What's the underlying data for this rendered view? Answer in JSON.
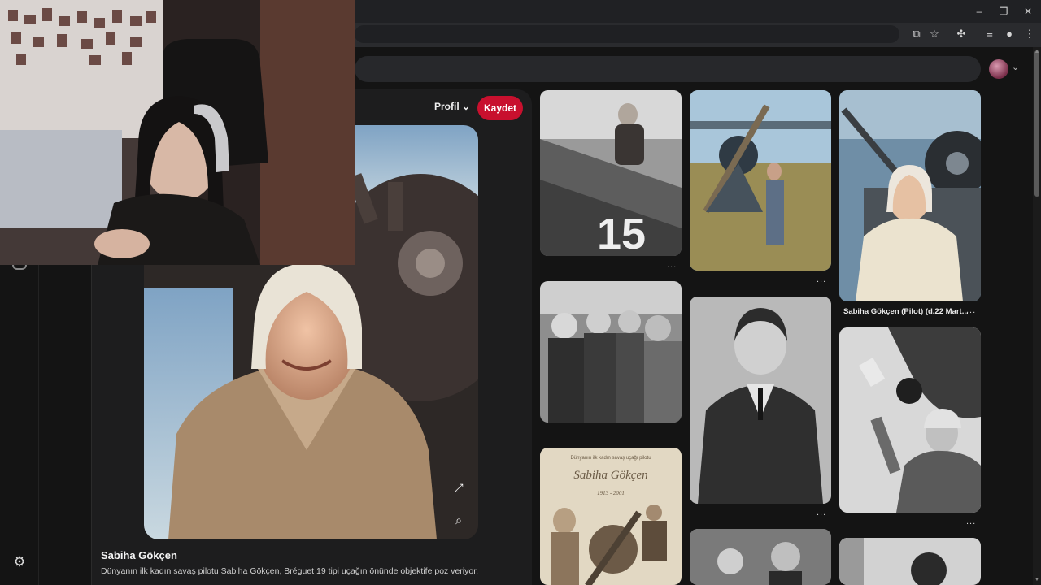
{
  "browser": {
    "window_controls": {
      "minimize": "–",
      "restore": "❐",
      "close": "✕"
    },
    "toolbar_icons": [
      "cast-icon",
      "star-icon",
      "extensions-icon",
      "media-icon",
      "profile-icon",
      "menu-icon"
    ]
  },
  "header": {
    "search_placeholder": ""
  },
  "pin": {
    "profile_label": "Profil",
    "save_label": "Kaydet",
    "title": "Sabiha Gökçen",
    "description": "Dünyanın ilk kadın savaş pilotu Sabiha Gökçen, Bréguet 19 tipi uçağın önünde objektife poz veriyor."
  },
  "grid": {
    "more_label": "...",
    "caption_3": "Sabiha Gökçen (Pilot) (d.22 Mart...",
    "poster_line1": "Dünyanın ilk kadın savaş uçağı pilotu",
    "poster_title": "Sabiha Gökçen",
    "poster_years": "1913 - 2001"
  },
  "colors": {
    "save_button": "#c8102e",
    "background": "#141414",
    "panel": "#1d1d1e"
  }
}
